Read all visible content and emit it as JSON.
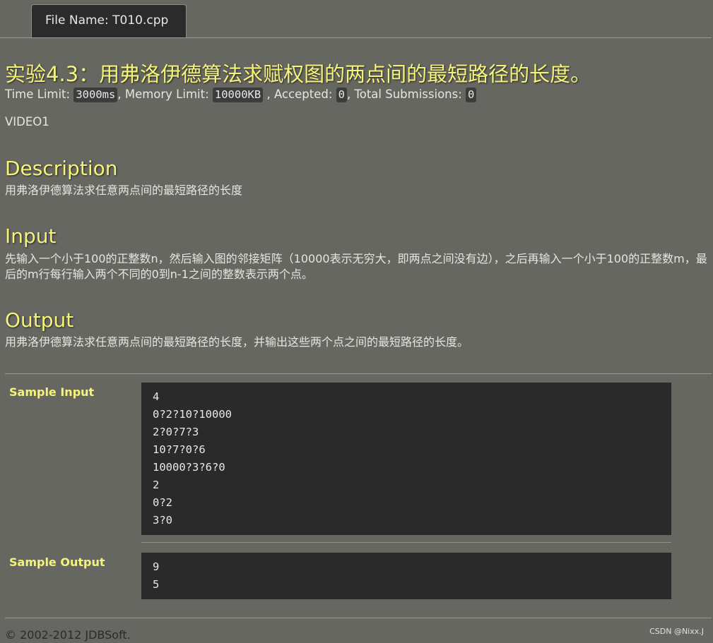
{
  "tab": {
    "label": "File Name:  T010.cpp"
  },
  "problem": {
    "title": "实验4.3：用弗洛伊德算法求赋权图的两点间的最短路径的长度。",
    "time_limit_label": "Time Limit: ",
    "time_limit": "3000ms",
    "memory_limit_label": ", Memory Limit: ",
    "memory_limit": "10000KB",
    "accepted_label": " , Accepted: ",
    "accepted": "0",
    "submissions_label": ", Total Submissions: ",
    "submissions": "0",
    "video": "VIDEO1"
  },
  "description": {
    "heading": "Description",
    "text": "用弗洛伊德算法求任意两点间的最短路径的长度"
  },
  "input": {
    "heading": "Input",
    "text": "先输入一个小于100的正整数n，然后输入图的邻接矩阵（10000表示无穷大，即两点之间没有边），之后再输入一个小于100的正整数m，最后的m行每行输入两个不同的0到n-1之间的整数表示两个点。"
  },
  "output": {
    "heading": "Output",
    "text": "用弗洛伊德算法求任意两点间的最短路径的长度，并输出这些两个点之间的最短路径的长度。"
  },
  "sample_input": {
    "label": "Sample Input",
    "lines": [
      "4",
      "0?2?10?10000",
      "2?0?7?3",
      "10?7?0?6",
      "10000?3?6?0",
      "2",
      "0?2",
      "3?0"
    ]
  },
  "sample_output": {
    "label": "Sample Output",
    "lines": [
      "9",
      "5"
    ]
  },
  "footer": {
    "copyright": "© 2002-2012  JDBSoft.",
    "watermark": "CSDN @Nixx.J"
  }
}
